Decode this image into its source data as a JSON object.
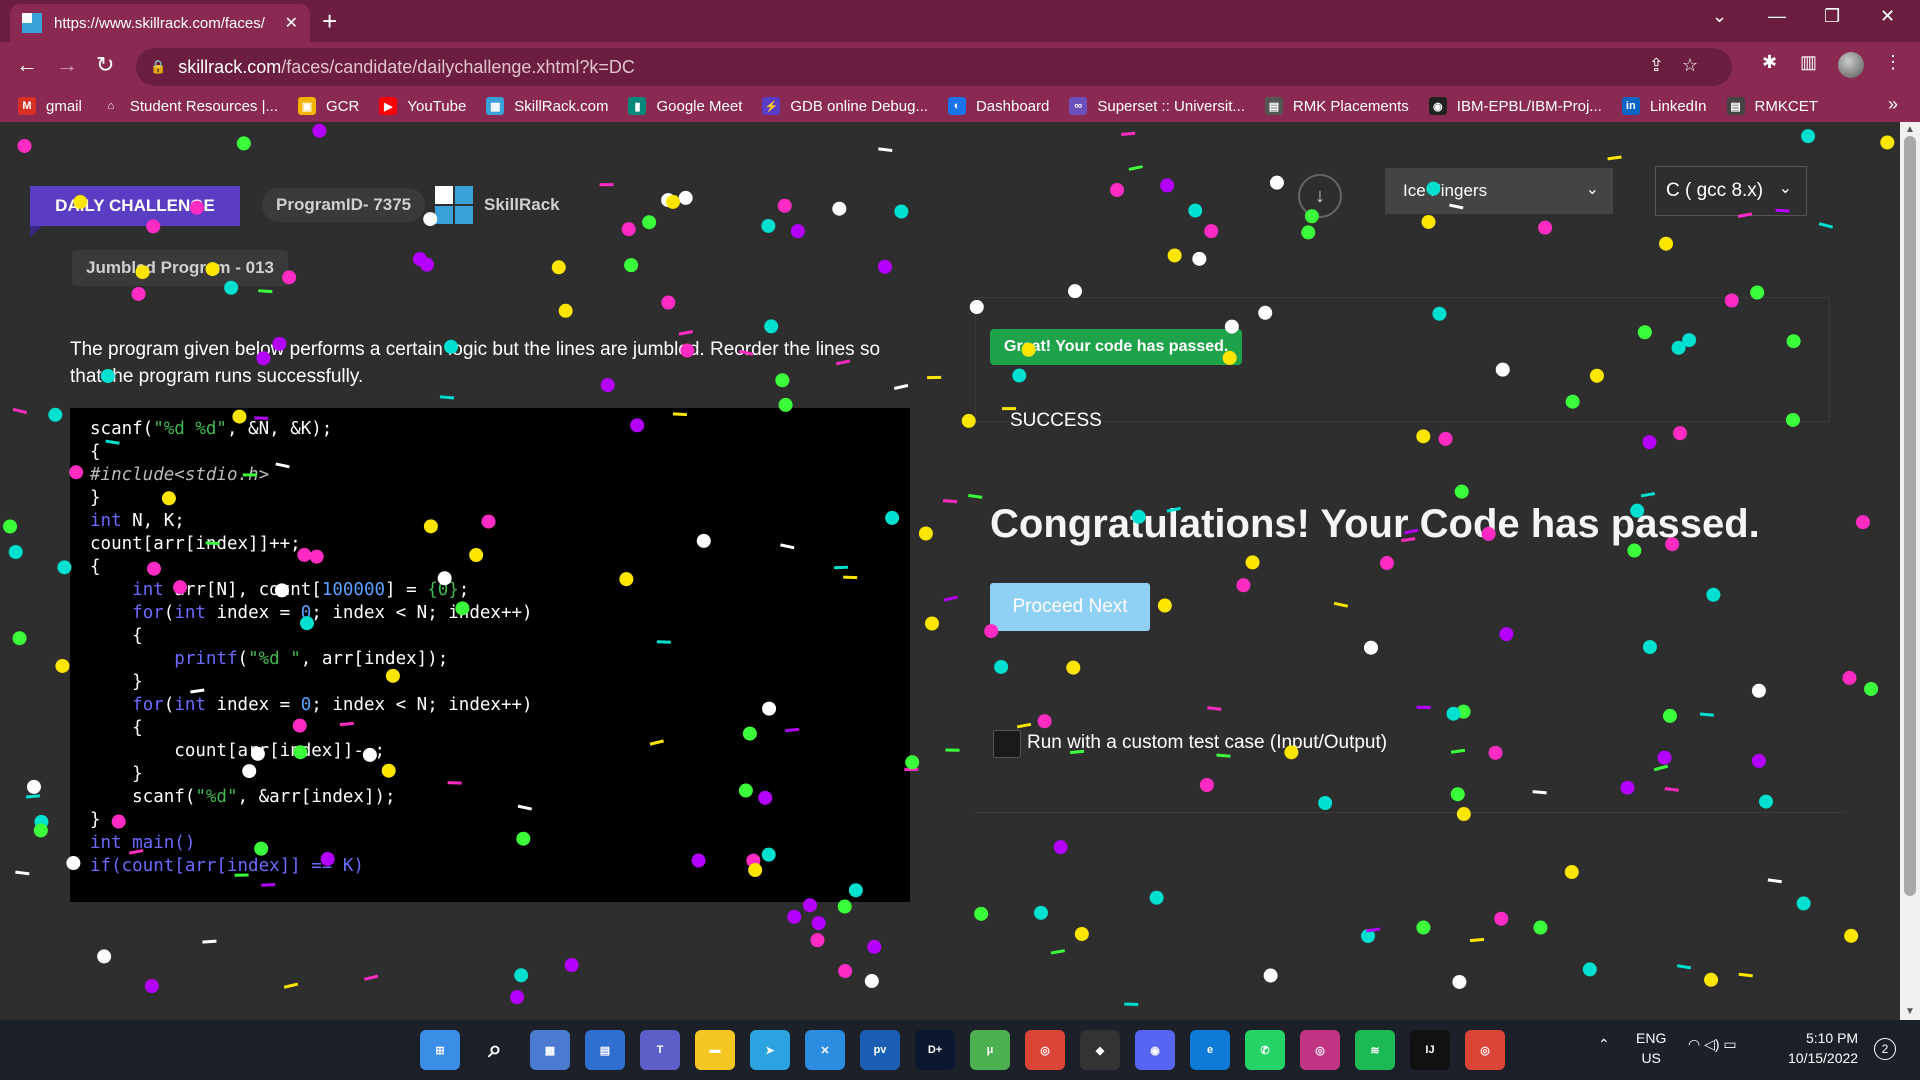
{
  "browser": {
    "tab_title": "https://www.skillrack.com/faces/",
    "tab_close": "✕",
    "new_tab": "+",
    "url_host": "skillrack.com",
    "url_path": "/faces/candidate/dailychallenge.xhtml?k=DC",
    "window_controls": {
      "chevron": "⌄",
      "minimize": "—",
      "restore": "❐",
      "close": "✕"
    },
    "bookmarks": [
      {
        "label": "gmail",
        "color": "#d93025",
        "glyph": "M"
      },
      {
        "label": "Student Resources |...",
        "color": "#8a2a52",
        "glyph": "⌂"
      },
      {
        "label": "GCR",
        "color": "#f4b400",
        "glyph": "▣"
      },
      {
        "label": "YouTube",
        "color": "#ff0000",
        "glyph": "▶"
      },
      {
        "label": "SkillRack.com",
        "color": "#3aa0d8",
        "glyph": "▦"
      },
      {
        "label": "Google Meet",
        "color": "#00897b",
        "glyph": "▮"
      },
      {
        "label": "GDB online Debug...",
        "color": "#5b3cc4",
        "glyph": "⚡"
      },
      {
        "label": "Dashboard",
        "color": "#1a73e8",
        "glyph": "◐"
      },
      {
        "label": "Superset :: Universit...",
        "color": "#6b4fbb",
        "glyph": "∞"
      },
      {
        "label": "RMK Placements",
        "color": "#555555",
        "glyph": "▤"
      },
      {
        "label": "IBM-EPBL/IBM-Proj...",
        "color": "#222222",
        "glyph": "◉"
      },
      {
        "label": "LinkedIn",
        "color": "#0a66c2",
        "glyph": "in"
      },
      {
        "label": "RMKCET",
        "color": "#444444",
        "glyph": "▤"
      }
    ],
    "bookmarks_more": "»"
  },
  "challenge": {
    "daily_label": "DAILY CHALLENGE",
    "program_id": "ProgramID- 7375",
    "brand": "SkillRack",
    "title": "Jumbled Program - 013",
    "description": "The program given below performs a certain logic but the lines are jumbled. Reorder the lines so that the program runs successfully."
  },
  "editor": {
    "theme": "Ice Fingers",
    "language": "C ( gcc 8.x)"
  },
  "result": {
    "badge": "Great! Your code has passed.",
    "status": "SUCCESS",
    "headline": "Congratulations! Your Code has passed.",
    "proceed_label": "Proceed Next",
    "custom_test_label": "Run with a custom test case (Input/Output)"
  },
  "taskbar": {
    "lang_top": "ENG",
    "lang_bottom": "US",
    "time": "5:10 PM",
    "date": "10/15/2022",
    "notifications": "2",
    "apps": [
      {
        "name": "start",
        "color": "#3a8ee6",
        "glyph": "⊞"
      },
      {
        "name": "search",
        "color": "transparent",
        "glyph": "⌕"
      },
      {
        "name": "widgets",
        "color": "#4a7bd0",
        "glyph": "▦"
      },
      {
        "name": "store",
        "color": "#2f6fd0",
        "glyph": "▤"
      },
      {
        "name": "teams",
        "color": "#5b5fc7",
        "glyph": "T"
      },
      {
        "name": "explorer",
        "color": "#f3c623",
        "glyph": "▬"
      },
      {
        "name": "telegram",
        "color": "#2aa3e0",
        "glyph": "➤"
      },
      {
        "name": "vscode",
        "color": "#2c8de0",
        "glyph": "✕"
      },
      {
        "name": "prime-video",
        "color": "#1a5fb4",
        "glyph": "pv"
      },
      {
        "name": "hotstar",
        "color": "#0c1730",
        "glyph": "D+"
      },
      {
        "name": "utorrent",
        "color": "#4caf50",
        "glyph": "μ"
      },
      {
        "name": "chrome",
        "color": "#db4437",
        "glyph": "◎"
      },
      {
        "name": "alienware",
        "color": "#333333",
        "glyph": "◆"
      },
      {
        "name": "discord",
        "color": "#5865f2",
        "glyph": "◉"
      },
      {
        "name": "edge",
        "color": "#0f7ad8",
        "glyph": "e"
      },
      {
        "name": "whatsapp",
        "color": "#25d366",
        "glyph": "✆"
      },
      {
        "name": "instagram",
        "color": "#c13584",
        "glyph": "◎"
      },
      {
        "name": "spotify",
        "color": "#1db954",
        "glyph": "≋"
      },
      {
        "name": "intellij",
        "color": "#111111",
        "glyph": "IJ"
      },
      {
        "name": "chrome-active",
        "color": "#db4437",
        "glyph": "◎"
      }
    ]
  }
}
